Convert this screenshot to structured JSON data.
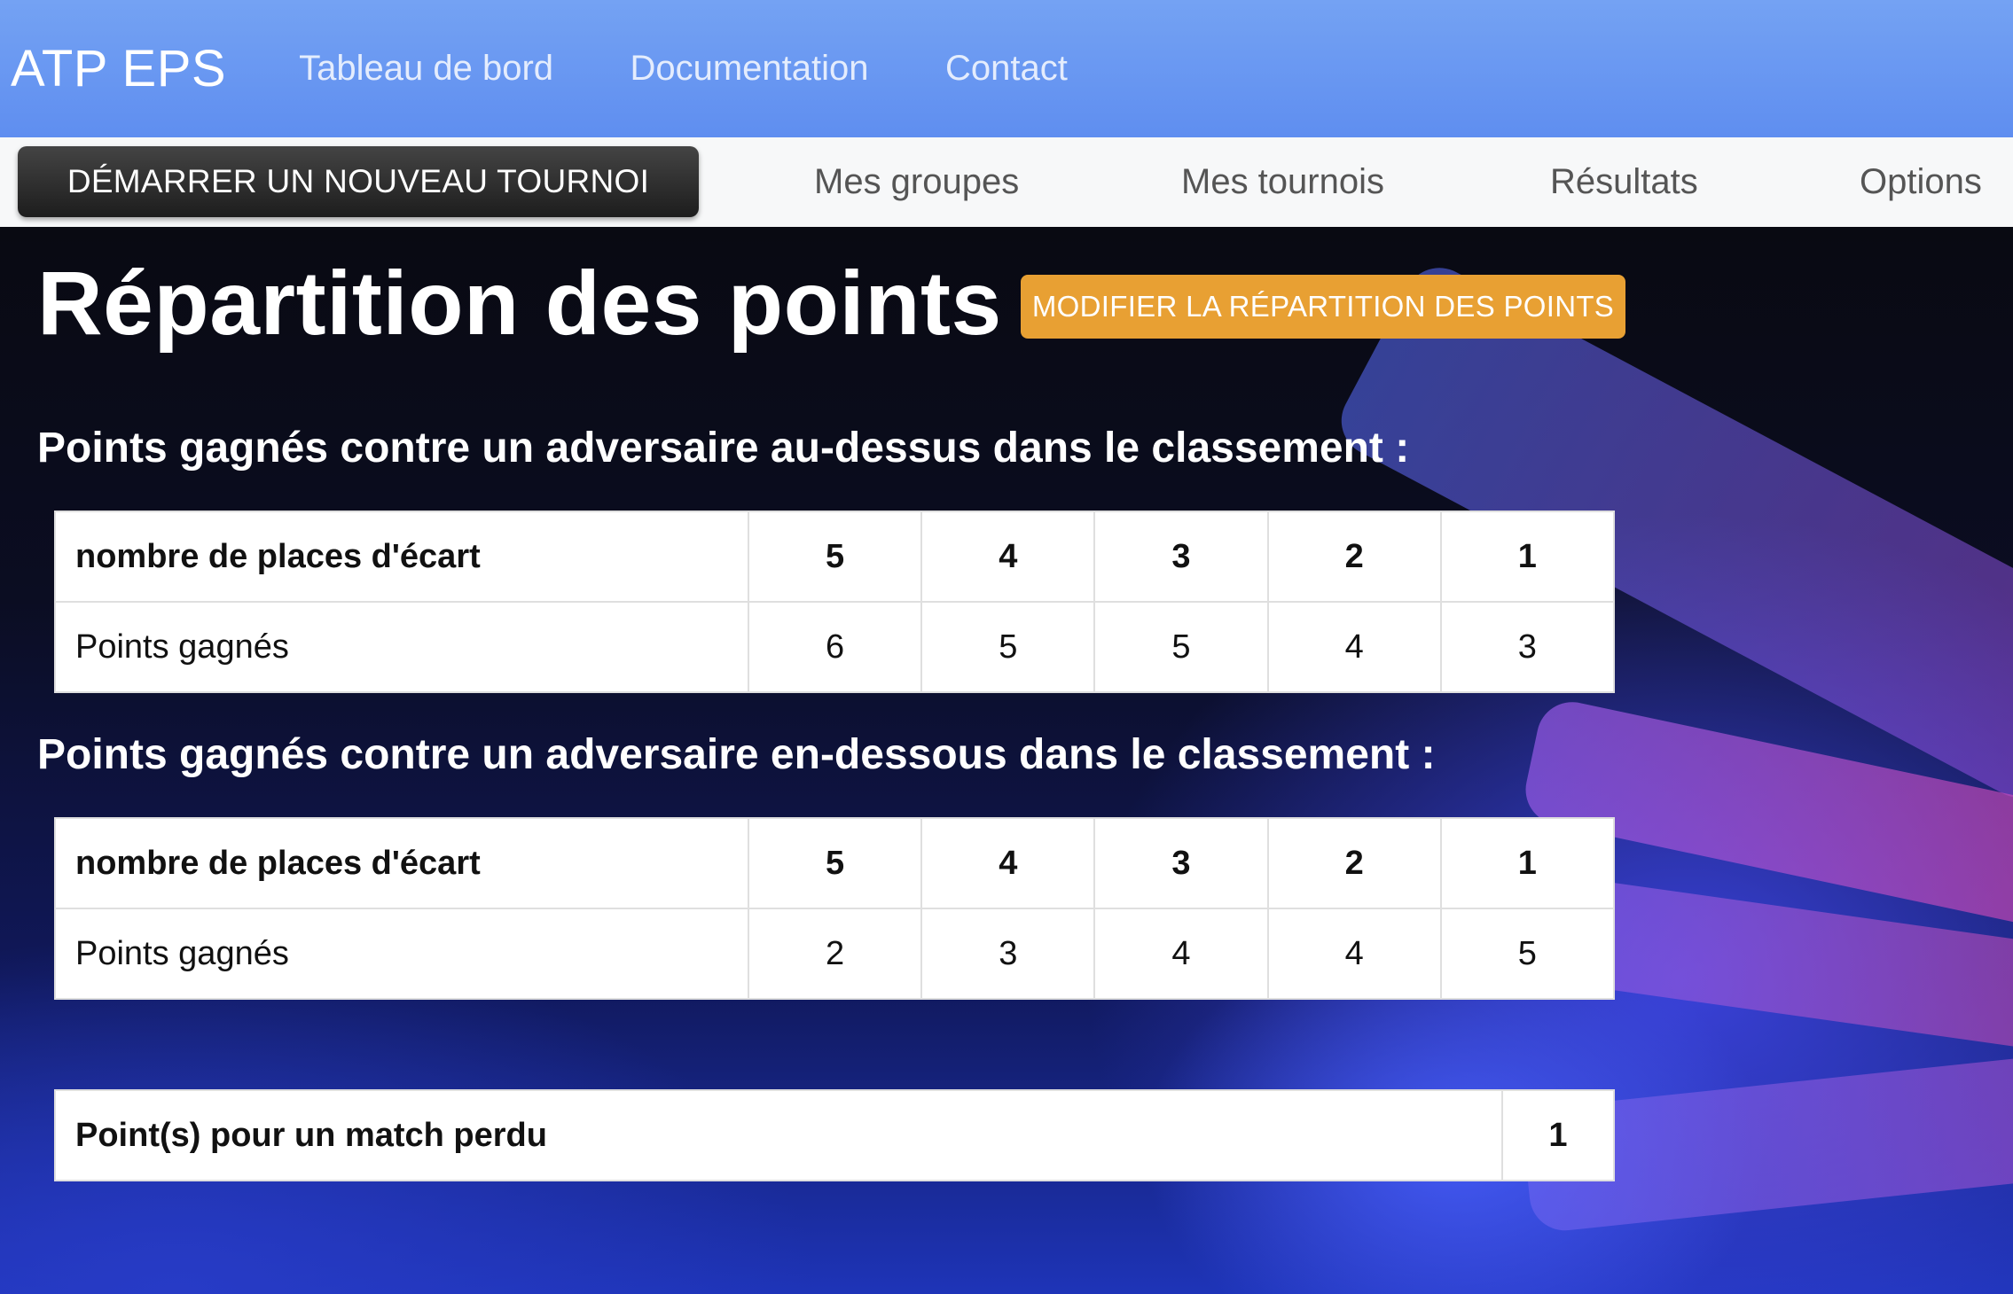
{
  "app": {
    "brand": "ATP EPS"
  },
  "topnav": [
    "Tableau de bord",
    "Documentation",
    "Contact"
  ],
  "subnav": {
    "start_button": "DÉMARRER UN NOUVEAU TOURNOI",
    "items": [
      "Mes groupes",
      "Mes tournois",
      "Résultats",
      "Options"
    ]
  },
  "page": {
    "title": "Répartition des points",
    "edit_button": "MODIFIER LA RÉPARTITION DES POINTS"
  },
  "above": {
    "title": "Points gagnés contre un adversaire au-dessus dans le classement :",
    "header": "nombre de places d'écart",
    "row_label": "Points gagnés",
    "gaps": [
      "5",
      "4",
      "3",
      "2",
      "1"
    ],
    "points": [
      "6",
      "5",
      "5",
      "4",
      "3"
    ]
  },
  "below": {
    "title": "Points gagnés contre un adversaire en-dessous dans le classement :",
    "header": "nombre de places d'écart",
    "row_label": "Points gagnés",
    "gaps": [
      "5",
      "4",
      "3",
      "2",
      "1"
    ],
    "points": [
      "2",
      "3",
      "4",
      "4",
      "5"
    ]
  },
  "lost_match": {
    "label": "Point(s) pour un match perdu",
    "value": "1"
  },
  "colors": {
    "topbar": "#6a98f2",
    "edit_button": "#e8a033",
    "start_button": "#2a2a2a"
  }
}
